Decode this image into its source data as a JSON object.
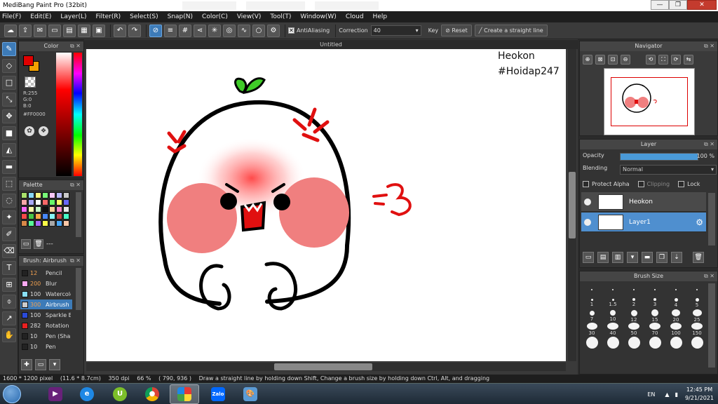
{
  "window": {
    "title": "MediBang Paint Pro (32bit)",
    "buttons": [
      "—",
      "❐",
      "✕"
    ]
  },
  "menu": [
    "File(F)",
    "Edit(E)",
    "Layer(L)",
    "Filter(R)",
    "Select(S)",
    "Snap(N)",
    "Color(C)",
    "View(V)",
    "Tool(T)",
    "Window(W)",
    "Cloud",
    "Help"
  ],
  "toolbar": {
    "antialiasing_label": "AntiAliasing",
    "antialiasing_checked": true,
    "correction_label": "Correction",
    "correction_value": "40",
    "key_label": "Key",
    "reset_label": "Reset",
    "straight_line_label": "Create a straight line"
  },
  "color_panel": {
    "title": "Color",
    "foreground": "#e10000",
    "background": "#f2a100",
    "r": "R:255",
    "g": "G:0",
    "b": "B:0",
    "hex": "#FF0000"
  },
  "palette_panel": {
    "title": "Palette",
    "colors": [
      "#a8e06a",
      "#88d8f8",
      "#f8f880",
      "#78f878",
      "#f8c8f8",
      "#b8b8f8",
      "#c8c8c8",
      "#f8a8a8",
      "#a8a8f8",
      "#f8f8f8",
      "#f86868",
      "#68f868",
      "#f8f868",
      "#6868f8",
      "#f868f8",
      "#f8f8a8",
      "#c8f8c8",
      "#111111",
      "#f8d098",
      "#f888c8",
      "#e8e8e8",
      "#f84848",
      "#48c848",
      "#f8a848",
      "#4888f8",
      "#88f8f8",
      "#c84848",
      "#48f8c8",
      "#d88848",
      "#58f898",
      "#a868f8",
      "#f8f848",
      "#a8a8a8",
      "#48a8f8",
      "#f8c8a8"
    ],
    "extra_label": "---"
  },
  "brush_panel": {
    "title": "Brush: Airbrush",
    "brushes": [
      {
        "size": "12",
        "name": "Pencil",
        "color": "#222222",
        "size_color": "#f0a050"
      },
      {
        "size": "200",
        "name": "Blur",
        "color": "#f8a8f0",
        "size_color": "#f0a050"
      },
      {
        "size": "100",
        "name": "Watercolor",
        "color": "#88e0f8",
        "size_color": "#dddddd"
      },
      {
        "size": "300",
        "name": "Airbrush",
        "color": "#cccccc",
        "size_color": "#f0a050",
        "selected": true
      },
      {
        "size": "100",
        "name": "Sparkle Brush",
        "color": "#2a4ad8",
        "size_color": "#dddddd"
      },
      {
        "size": "282",
        "name": "Rotation",
        "color": "#e82020",
        "size_color": "#dddddd"
      },
      {
        "size": "10",
        "name": "Pen (Shape)",
        "color": "#222222",
        "size_color": "#dddddd"
      },
      {
        "size": "10",
        "name": "Pen",
        "color": "#222222",
        "size_color": "#dddddd"
      }
    ]
  },
  "canvas": {
    "tab": "Untitled",
    "watermark_name": "Heokon",
    "watermark_tag": "#Hoidap247"
  },
  "navigator": {
    "title": "Navigator"
  },
  "layer_panel": {
    "title": "Layer",
    "opacity_label": "Opacity",
    "opacity_value": "100 %",
    "opacity_fraction": 1.0,
    "blending_label": "Blending",
    "blending_value": "Normal",
    "protect_alpha": "Protect Alpha",
    "clipping": "Clipping",
    "lock": "Lock",
    "layers": [
      {
        "name": "Heokon",
        "selected": false
      },
      {
        "name": "Layer1",
        "selected": true
      }
    ]
  },
  "brush_size_panel": {
    "title": "Brush Size",
    "sizes": [
      "·",
      "·",
      "·",
      "·",
      "·",
      "·",
      "1",
      "1.5",
      "2",
      "3",
      "4",
      "5",
      "7",
      "10",
      "12",
      "15",
      "20",
      "25",
      "30",
      "40",
      "50",
      "70",
      "100",
      "150",
      "",
      "",
      "",
      "",
      "",
      ""
    ]
  },
  "status": {
    "dimensions": "1600 * 1200 pixel",
    "physical": "(11.6 * 8.7cm)",
    "dpi": "350 dpi",
    "zoom": "66 %",
    "coords": "( 790, 936 )",
    "hint": "Draw a straight line by holding down Shift, Change a brush size by holding down Ctrl, Alt, and dragging"
  },
  "taskbar": {
    "lang": "EN",
    "time": "12:45 PM",
    "date": "9/21/2021",
    "apps": [
      "visual-studio",
      "internet-explorer",
      "unikey",
      "chrome",
      "medibang",
      "zalo",
      "paint"
    ]
  }
}
